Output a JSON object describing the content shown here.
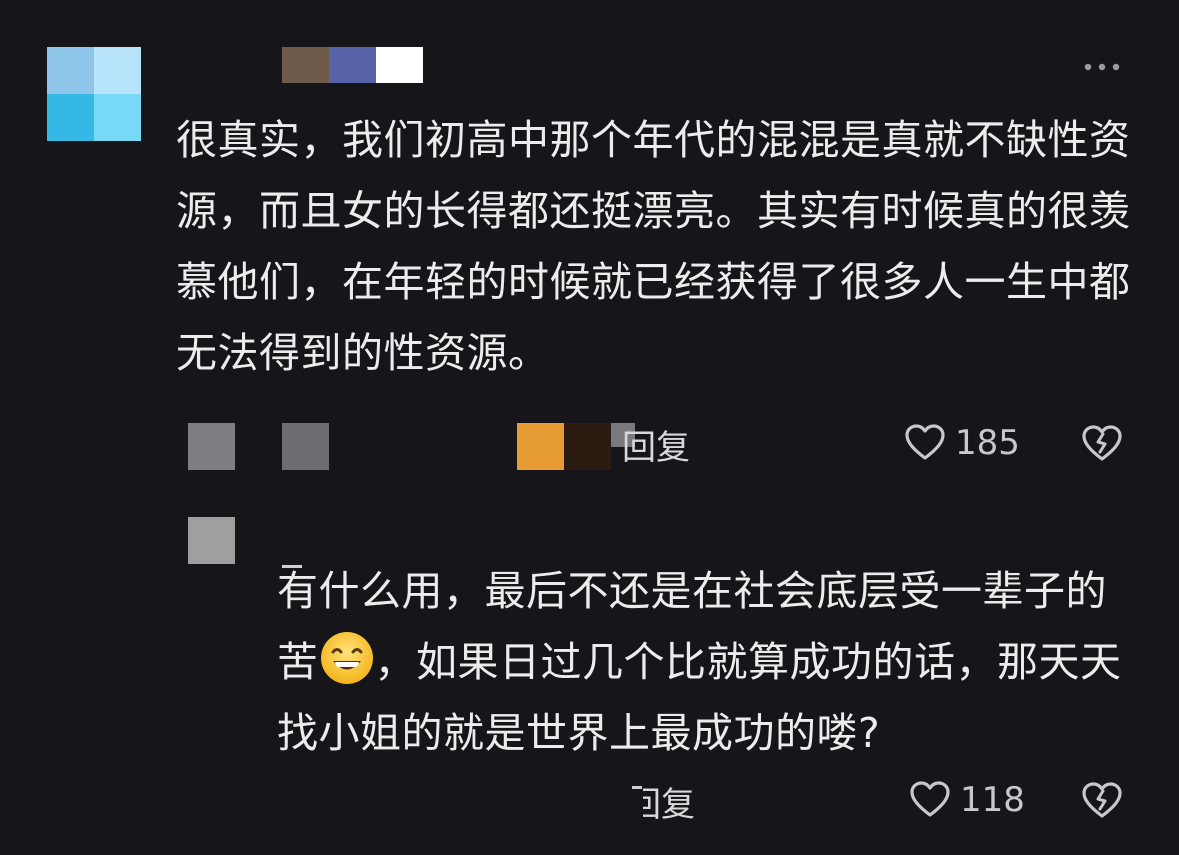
{
  "comment": {
    "text": "很真实，我们初高中那个年代的混混是真就不缺性资源，而且女的长得都还挺漂亮。其实有时候真的很羡慕他们，在年轻的时候就已经获得了很多人一生中都无法得到的性资源。",
    "reply_label": "回复",
    "like_count": "185",
    "more_icon": "ellipsis-icon"
  },
  "reply": {
    "text_before_emoji": "有什么用，最后不还是在社会底层受一辈子的苦",
    "emoji": "grinning-face-icon",
    "text_after_emoji": "，如果日过几个比就算成功的话，那天天找小姐的就是世界上最成功的喽?",
    "reply_label": "回复",
    "like_count": "118"
  },
  "colors": {
    "background": "#16161a",
    "text": "#ececee",
    "muted": "#c8c8cc"
  }
}
